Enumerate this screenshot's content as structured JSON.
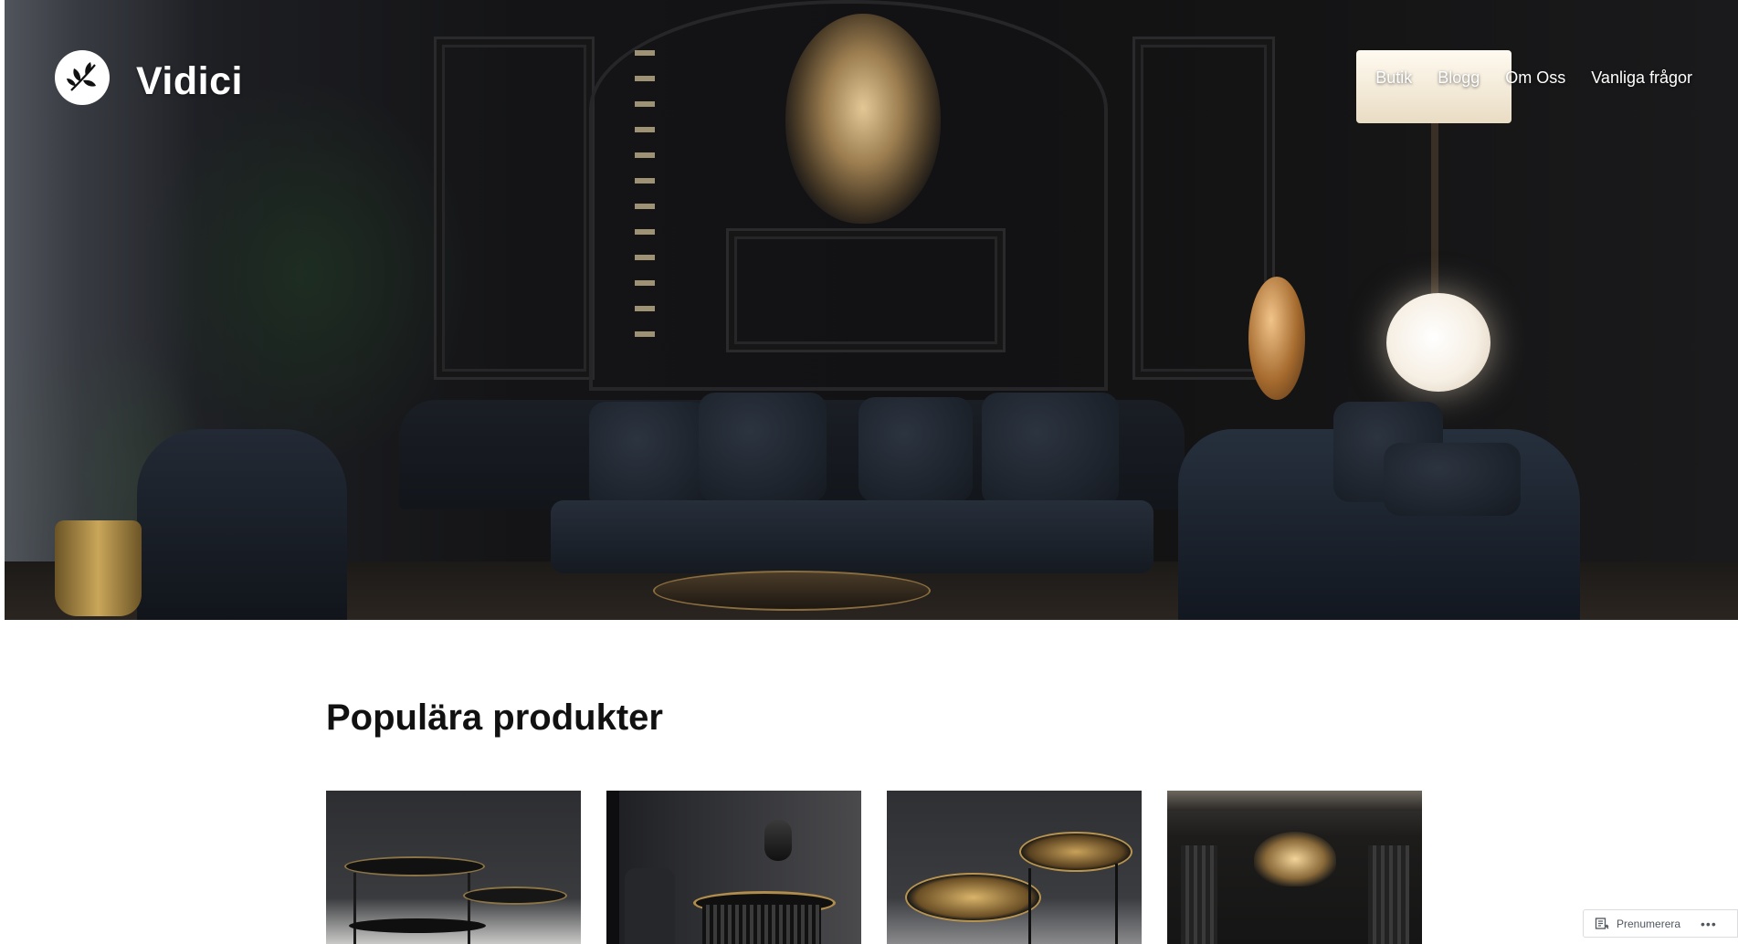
{
  "site": {
    "title": "Vidici",
    "logo_icon": "leaf-branch-icon"
  },
  "nav": {
    "items": [
      {
        "label": "Butik"
      },
      {
        "label": "Blogg"
      },
      {
        "label": "Om Oss"
      },
      {
        "label": "Vanliga frågor"
      }
    ]
  },
  "hero": {
    "image": "dark-luxury-living-room"
  },
  "products_section": {
    "title": "Populära produkter",
    "products": [
      {
        "image": "black-marble-side-tables"
      },
      {
        "image": "round-black-gold-side-table-with-lamp"
      },
      {
        "image": "gold-tray-nesting-tables"
      },
      {
        "image": "dark-room-with-gold-chandelier"
      }
    ]
  },
  "subscribe": {
    "label": "Prenumerera",
    "icon": "subscribe-reader-icon",
    "more": "•••"
  },
  "colors": {
    "text": "#111111",
    "nav_text": "#ffffff",
    "background": "#ffffff"
  }
}
